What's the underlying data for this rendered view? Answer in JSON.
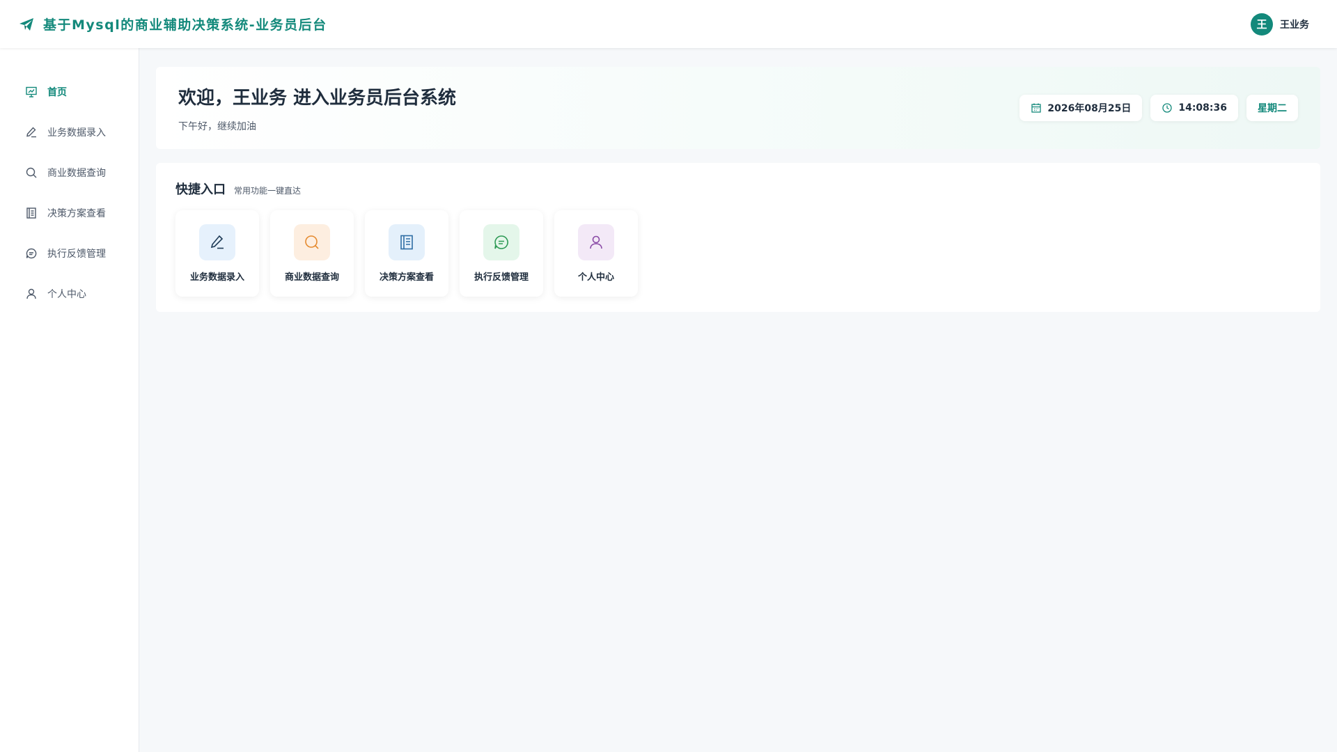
{
  "header": {
    "title": "基于Mysql的商业辅助决策系统-业务员后台",
    "brand_icon": "paper-plane-icon",
    "user": {
      "avatar_text": "王",
      "name": "王业务"
    }
  },
  "sidebar": {
    "items": [
      {
        "label": "首页",
        "icon": "presentation-chart-icon",
        "active": true
      },
      {
        "label": "业务数据录入",
        "icon": "edit-icon",
        "active": false
      },
      {
        "label": "商业数据查询",
        "icon": "search-icon",
        "active": false
      },
      {
        "label": "决策方案查看",
        "icon": "notebook-icon",
        "active": false
      },
      {
        "label": "执行反馈管理",
        "icon": "chat-bubble-icon",
        "active": false
      },
      {
        "label": "个人中心",
        "icon": "user-icon",
        "active": false
      }
    ]
  },
  "welcome": {
    "title": "欢迎，王业务 进入业务员后台系统",
    "subtitle": "下午好，继续加油",
    "date": "2026年08月25日",
    "time": "14:08:36",
    "weekday": "星期二"
  },
  "quick": {
    "title": "快捷入口",
    "subtitle": "常用功能一键直达",
    "tiles": [
      {
        "label": "业务数据录入",
        "icon": "edit-icon",
        "bg": "#e6f1fc",
        "fg": "#1f3b57"
      },
      {
        "label": "商业数据查询",
        "icon": "search-icon",
        "bg": "#fdeee0",
        "fg": "#e58a2e"
      },
      {
        "label": "决策方案查看",
        "icon": "notebook-icon",
        "bg": "#e4f0fb",
        "fg": "#2e6da4"
      },
      {
        "label": "执行反馈管理",
        "icon": "chat-bubble-icon",
        "bg": "#e4f6ea",
        "fg": "#2e9a55"
      },
      {
        "label": "个人中心",
        "icon": "user-icon",
        "bg": "#f3e9f7",
        "fg": "#8a4aa6"
      }
    ]
  },
  "colors": {
    "accent": "#13897b",
    "background": "#f6f8fa"
  }
}
